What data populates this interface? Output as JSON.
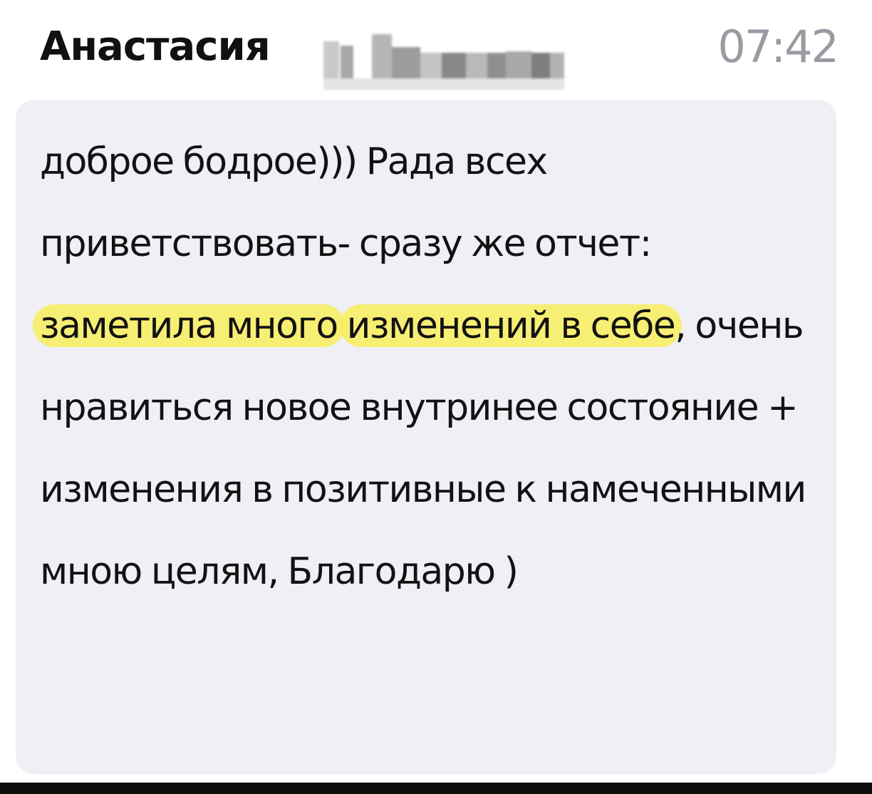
{
  "message": {
    "sender_name": "Анастасия",
    "time": "07:42",
    "text": {
      "part1": "доброе бодрое))) Рада всех приветствовать- сразу же отчет: ",
      "highlight1": "заметила много",
      "space": " ",
      "highlight2": "изменений в себе",
      "part2": ", очень нравиться новое внутринее состояние + изменения в позитивные к намеченными мною целям, Благодарю )"
    },
    "highlight_color": "#f7ee5c",
    "bubble_color": "#f0eff6"
  }
}
